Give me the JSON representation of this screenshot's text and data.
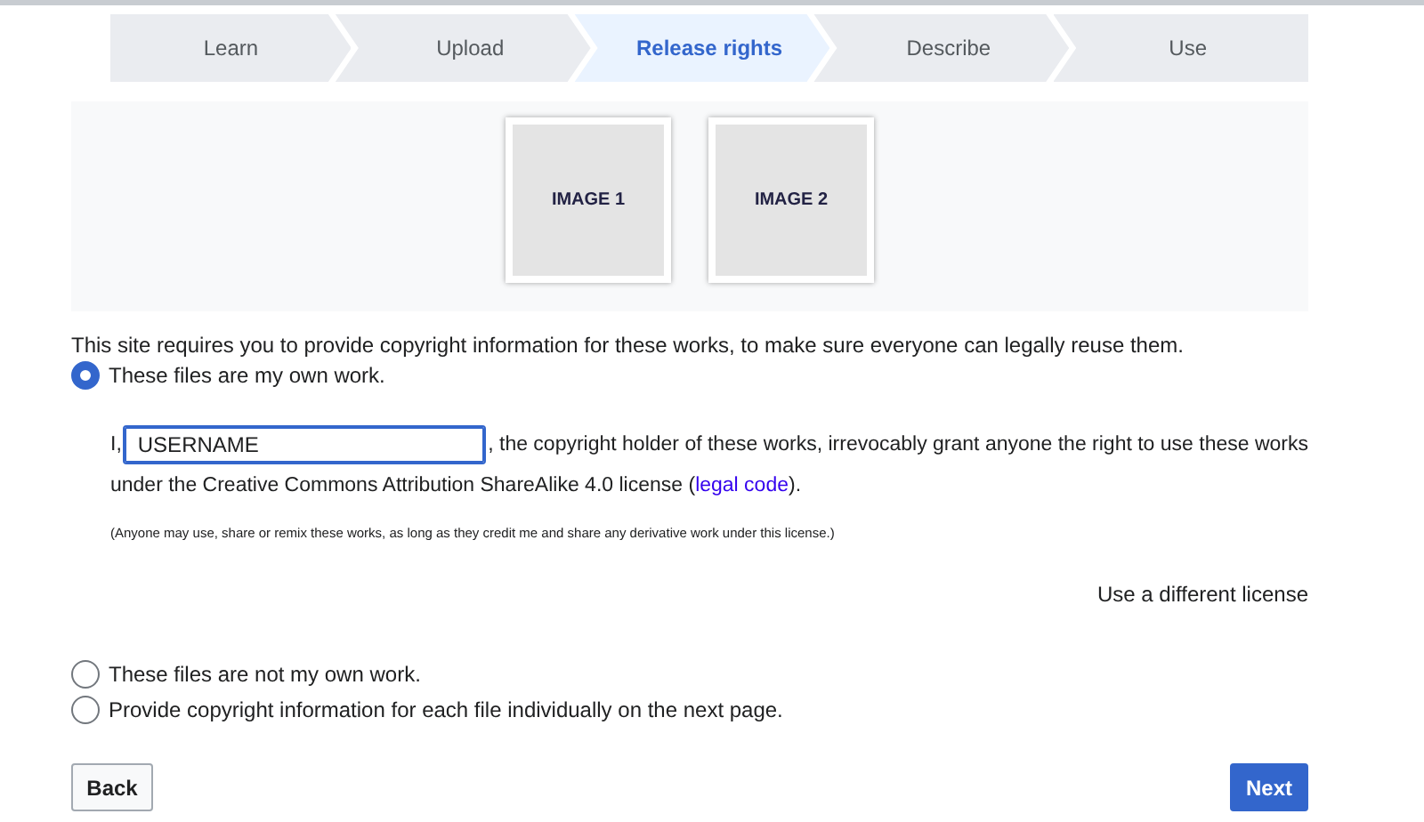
{
  "steps": [
    {
      "label": "Learn",
      "selected": false
    },
    {
      "label": "Upload",
      "selected": false
    },
    {
      "label": "Release rights",
      "selected": true
    },
    {
      "label": "Describe",
      "selected": false
    },
    {
      "label": "Use",
      "selected": false
    }
  ],
  "thumbnails": [
    {
      "label": "IMAGE 1"
    },
    {
      "label": "IMAGE 2"
    }
  ],
  "intro": "This site requires you to provide copyright information for these works, to make sure everyone can legally reuse them.",
  "options": [
    {
      "label": "These files are my own work.",
      "selected": true
    },
    {
      "label": "These files are not my own work.",
      "selected": false
    },
    {
      "label": "Provide copyright information for each file individually on the next page.",
      "selected": false
    }
  ],
  "own_work": {
    "prefix": "I,",
    "name_field": {
      "value": "USERNAME"
    },
    "statement": ", the copyright holder of these works, irrevocably grant anyone the right to use these works",
    "statement_line2": "under the Creative Commons Attribution ShareAlike 4.0 license (",
    "link": "legal code",
    "statement_end": ").",
    "note": "(Anyone may use, share or remix these works, as long as they credit me and share any derivative work under this license.)",
    "different_license": "Use a different license"
  },
  "buttons": {
    "back": "Back",
    "next": "Next"
  }
}
